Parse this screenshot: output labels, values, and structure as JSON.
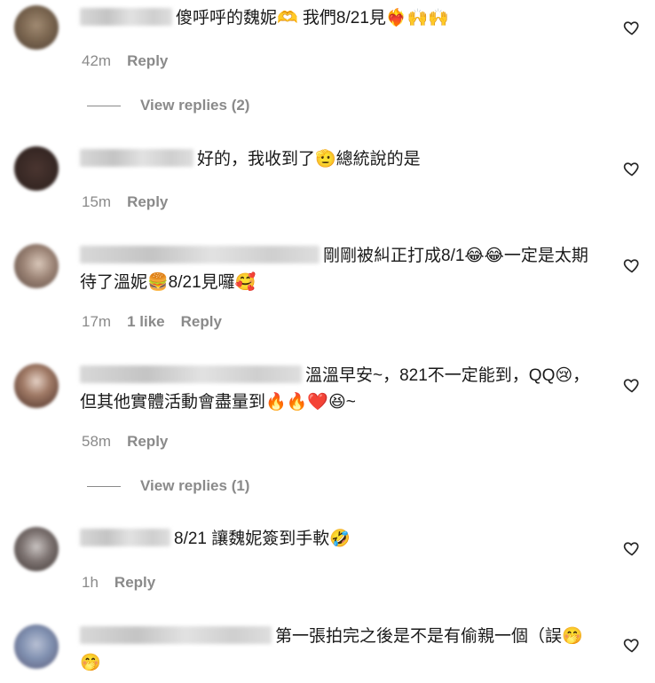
{
  "comments": [
    {
      "text": "傻呼呼的魏妮🫶 我們8/21見❤️‍🔥🙌🙌",
      "age": "42m",
      "likes": "",
      "reply": "Reply",
      "view_replies": "View replies (2)"
    },
    {
      "text": "好的，我收到了🫡總統說的是",
      "age": "15m",
      "likes": "",
      "reply": "Reply",
      "view_replies": ""
    },
    {
      "text": "剛剛被糾正打成8/1😂😂一定是太期待了溫妮🍔8/21見囉🥰",
      "age": "17m",
      "likes": "1 like",
      "reply": "Reply",
      "view_replies": ""
    },
    {
      "text": "溫溫早安~，821不一定能到，QQ😢，但其他實體活動會盡量到🔥🔥❤️😆~",
      "age": "58m",
      "likes": "",
      "reply": "Reply",
      "view_replies": "View replies (1)"
    },
    {
      "text": "8/21 讓魏妮簽到手軟🤣",
      "age": "1h",
      "likes": "",
      "reply": "Reply",
      "view_replies": ""
    },
    {
      "text": "第一張拍完之後是不是有偷親一個（誤🤭🤭",
      "age": "",
      "likes": "",
      "reply": "",
      "view_replies": ""
    }
  ],
  "icons": {
    "like": "heart-outline-icon"
  },
  "colors": {
    "meta": "#8a8a8a",
    "text": "#1a1a1a",
    "background": "#ffffff"
  }
}
